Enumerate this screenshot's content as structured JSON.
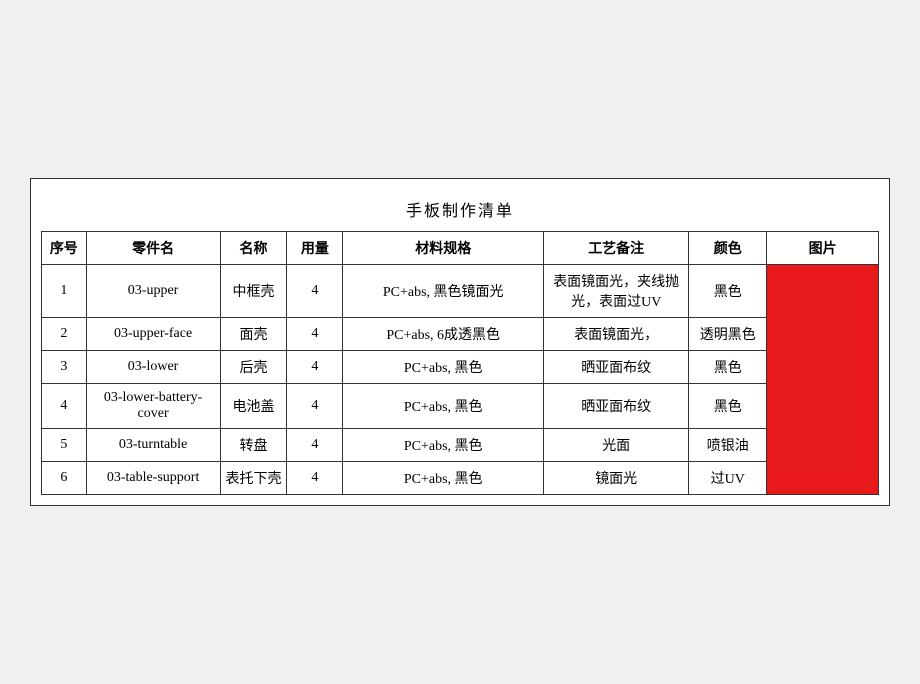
{
  "title": "手板制作清单",
  "headers": {
    "seq": "序号",
    "partCode": "零件名",
    "name": "名称",
    "qty": "用量",
    "spec": "材料规格",
    "process": "工艺备注",
    "color": "颜色",
    "image": "图片"
  },
  "rows": [
    {
      "seq": "1",
      "partCode": "03-upper",
      "name": "中框壳",
      "qty": "4",
      "spec": "PC+abs, 黑色镜面光",
      "process": "表面镜面光，夹线抛光，表面过UV",
      "color": "黑色"
    },
    {
      "seq": "2",
      "partCode": "03-upper-face",
      "name": "面壳",
      "qty": "4",
      "spec": "PC+abs, 6成透黑色",
      "process": "表面镜面光，",
      "color": "透明黑色"
    },
    {
      "seq": "3",
      "partCode": "03-lower",
      "name": "后壳",
      "qty": "4",
      "spec": "PC+abs, 黑色",
      "process": "晒亚面布纹",
      "color": "黑色"
    },
    {
      "seq": "4",
      "partCode": "03-lower-battery-cover",
      "name": "电池盖",
      "qty": "4",
      "spec": "PC+abs, 黑色",
      "process": "晒亚面布纹",
      "color": "黑色"
    },
    {
      "seq": "5",
      "partCode": "03-turntable",
      "name": "转盘",
      "qty": "4",
      "spec": "PC+abs, 黑色",
      "process": "光面",
      "color": "喷银油"
    },
    {
      "seq": "6",
      "partCode": "03-table-support",
      "name": "表托下壳",
      "qty": "4",
      "spec": "PC+abs, 黑色",
      "process": "镜面光",
      "color": "过UV"
    }
  ]
}
